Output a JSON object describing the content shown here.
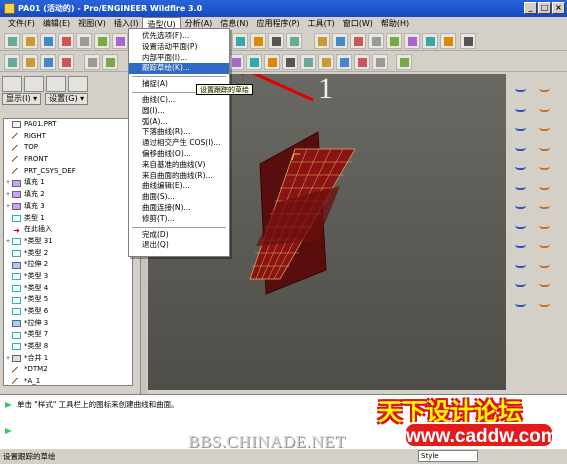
{
  "window": {
    "title": "PA01 (活动的) - Pro/ENGINEER Wildfire 3.0",
    "controls": [
      "_",
      "□",
      "×"
    ]
  },
  "menubar": {
    "items": [
      "文件(F)",
      "编辑(E)",
      "视图(V)",
      "插入(I)",
      "造型(U)",
      "分析(A)",
      "信息(N)",
      "应用程序(P)",
      "工具(T)",
      "窗口(W)",
      "帮助(H)"
    ],
    "active_index": 4
  },
  "style_menu": {
    "items": [
      {
        "label": "优先选项(F)...",
        "group": 0
      },
      {
        "label": "设置活动平面(P)",
        "group": 0
      },
      {
        "label": "内部平面(I)...",
        "group": 0
      },
      {
        "label": "跟踪草绘(K)...",
        "group": 0,
        "selected": true
      },
      {
        "label": "捕捉(A)",
        "group": 1
      },
      {
        "label": "曲线(C)...",
        "group": 2
      },
      {
        "label": "圆(I)...",
        "group": 2
      },
      {
        "label": "弧(A)...",
        "group": 2
      },
      {
        "label": "下落曲线(R)...",
        "group": 2
      },
      {
        "label": "通过相交产生 COS(I)...",
        "group": 2
      },
      {
        "label": "偏移曲线(O)...",
        "group": 2
      },
      {
        "label": "来自基准的曲线(V)",
        "group": 2
      },
      {
        "label": "来自曲面的曲线(R)...",
        "group": 2
      },
      {
        "label": "曲线编辑(E)...",
        "group": 2
      },
      {
        "label": "曲面(S)...",
        "group": 2
      },
      {
        "label": "曲面连接(N)...",
        "group": 2
      },
      {
        "label": "修剪(T)...",
        "group": 2
      },
      {
        "label": "完成(D)",
        "group": 3
      },
      {
        "label": "退出(Q)",
        "group": 3
      }
    ]
  },
  "tooltip": "设置跟踪的草绘",
  "callout_number": "1",
  "panel": {
    "show_button": "显示(I) ▾",
    "settings_button": "设置(G) ▾"
  },
  "model_tree": [
    {
      "label": "PA01.PRT",
      "icon": "part",
      "twisty": ""
    },
    {
      "label": "RIGHT",
      "icon": "plane",
      "twisty": ""
    },
    {
      "label": "TOP",
      "icon": "plane",
      "twisty": ""
    },
    {
      "label": "FRONT",
      "icon": "plane",
      "twisty": ""
    },
    {
      "label": "PRT_CSYS_DEF",
      "icon": "plane",
      "twisty": ""
    },
    {
      "label": "填充 1",
      "icon": "fill",
      "twisty": "+"
    },
    {
      "label": "填充 2",
      "icon": "fill",
      "twisty": "+"
    },
    {
      "label": "填充 3",
      "icon": "fill",
      "twisty": "+"
    },
    {
      "label": "类型 1",
      "icon": "sketch",
      "twisty": ""
    },
    {
      "label": "在此插入",
      "icon": "insert",
      "twisty": ""
    },
    {
      "label": "*类型 31",
      "icon": "sketch",
      "twisty": "+"
    },
    {
      "label": "*类型 2",
      "icon": "sketch",
      "twisty": ""
    },
    {
      "label": "*拉伸 2",
      "icon": "stretch",
      "twisty": ""
    },
    {
      "label": "*类型 3",
      "icon": "sketch",
      "twisty": ""
    },
    {
      "label": "*类型 4",
      "icon": "sketch",
      "twisty": ""
    },
    {
      "label": "*类型 5",
      "icon": "sketch",
      "twisty": ""
    },
    {
      "label": "*类型 6",
      "icon": "sketch",
      "twisty": ""
    },
    {
      "label": "*拉伸 3",
      "icon": "stretch",
      "twisty": ""
    },
    {
      "label": "*类型 7",
      "icon": "sketch",
      "twisty": ""
    },
    {
      "label": "*类型 8",
      "icon": "sketch",
      "twisty": ""
    },
    {
      "label": "*合并 1",
      "icon": "merge",
      "twisty": "+"
    },
    {
      "label": "*DTM2",
      "icon": "plane",
      "twisty": ""
    },
    {
      "label": "*A_1",
      "icon": "plane",
      "twisty": ""
    }
  ],
  "messages": [
    "单击 \"样式\" 工具栏上的图标来创建曲线和曲面。",
    ""
  ],
  "statusbar": {
    "text": "设置跟踪的草绘",
    "smart_filter": "Style"
  },
  "watermarks": {
    "bbs": "BBS.CHINADE.NET",
    "cn": "天下设计论坛",
    "url": "www.caddw.com"
  },
  "colors": {
    "titlebar": "#1549c4",
    "menu_selection": "#316ac5",
    "surface": "#7a1010",
    "viewport_bg": "#5e5c56"
  }
}
